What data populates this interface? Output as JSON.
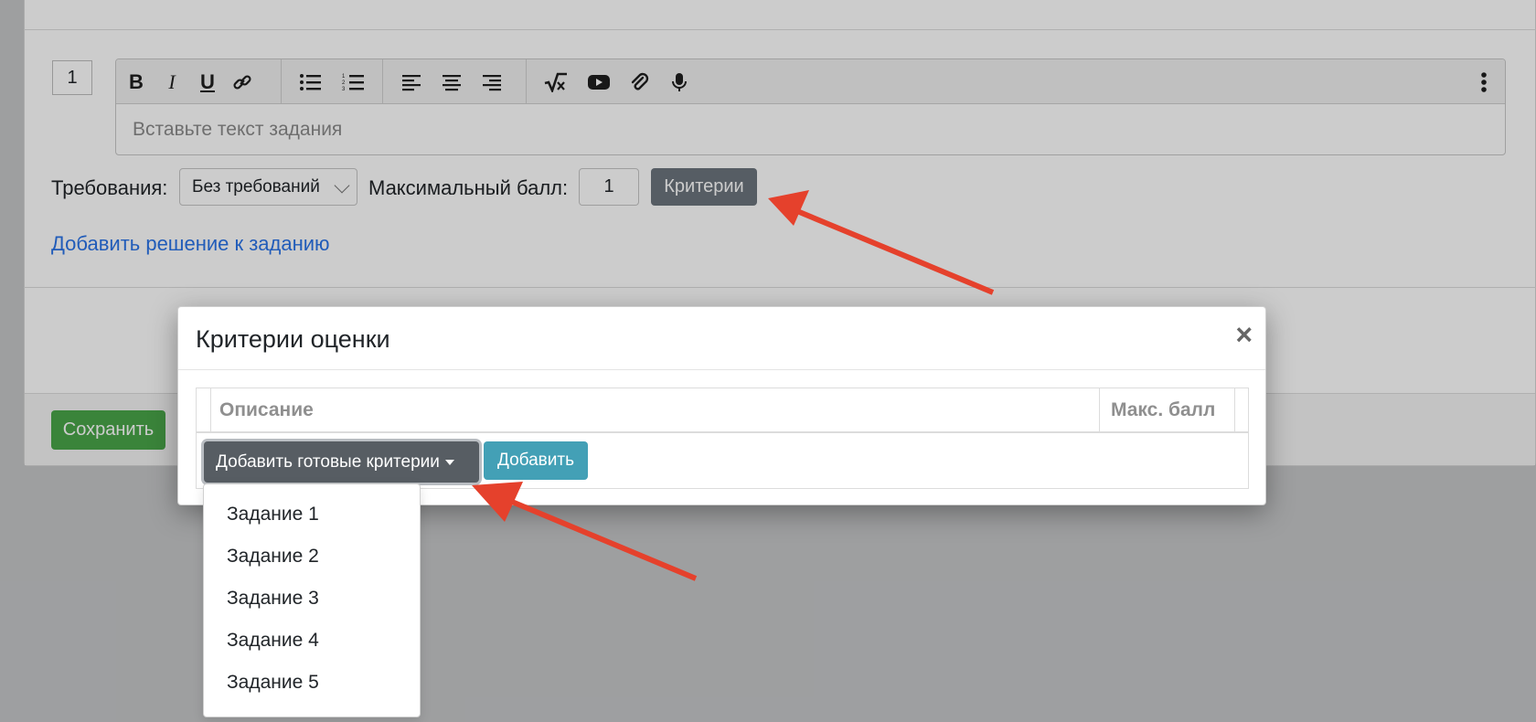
{
  "task": {
    "number": "1"
  },
  "editor": {
    "placeholder": "Вставьте текст задания",
    "toolbar_icons": [
      "bold-icon",
      "italic-icon",
      "underline-icon",
      "link-icon",
      "bullet-list-icon",
      "numbered-list-icon",
      "align-left-icon",
      "align-center-icon",
      "align-right-icon",
      "formula-icon",
      "video-icon",
      "attachment-icon",
      "microphone-icon",
      "more-vertical-icon"
    ]
  },
  "form": {
    "requirements_label": "Требования:",
    "requirements_value": "Без требований",
    "max_score_label": "Максимальный балл:",
    "max_score_value": "1",
    "criteria_button": "Критерии",
    "add_solution_link": "Добавить решение к заданию",
    "save_button": "Сохранить"
  },
  "modal": {
    "title": "Критерии оценки",
    "close": "×",
    "table_headers": {
      "description": "Описание",
      "max_score": "Макс. балл"
    },
    "ready_criteria_button": "Добавить готовые критерии",
    "add_button": "Добавить",
    "dropdown_items": [
      "Задание 1",
      "Задание 2",
      "Задание 3",
      "Задание 4",
      "Задание 5"
    ]
  },
  "colors": {
    "primary_link": "#2a73e8",
    "save_green": "#49a649",
    "add_teal": "#43a0b6",
    "secondary_gray": "#6c757d",
    "annotation_arrow": "#e5412c"
  }
}
